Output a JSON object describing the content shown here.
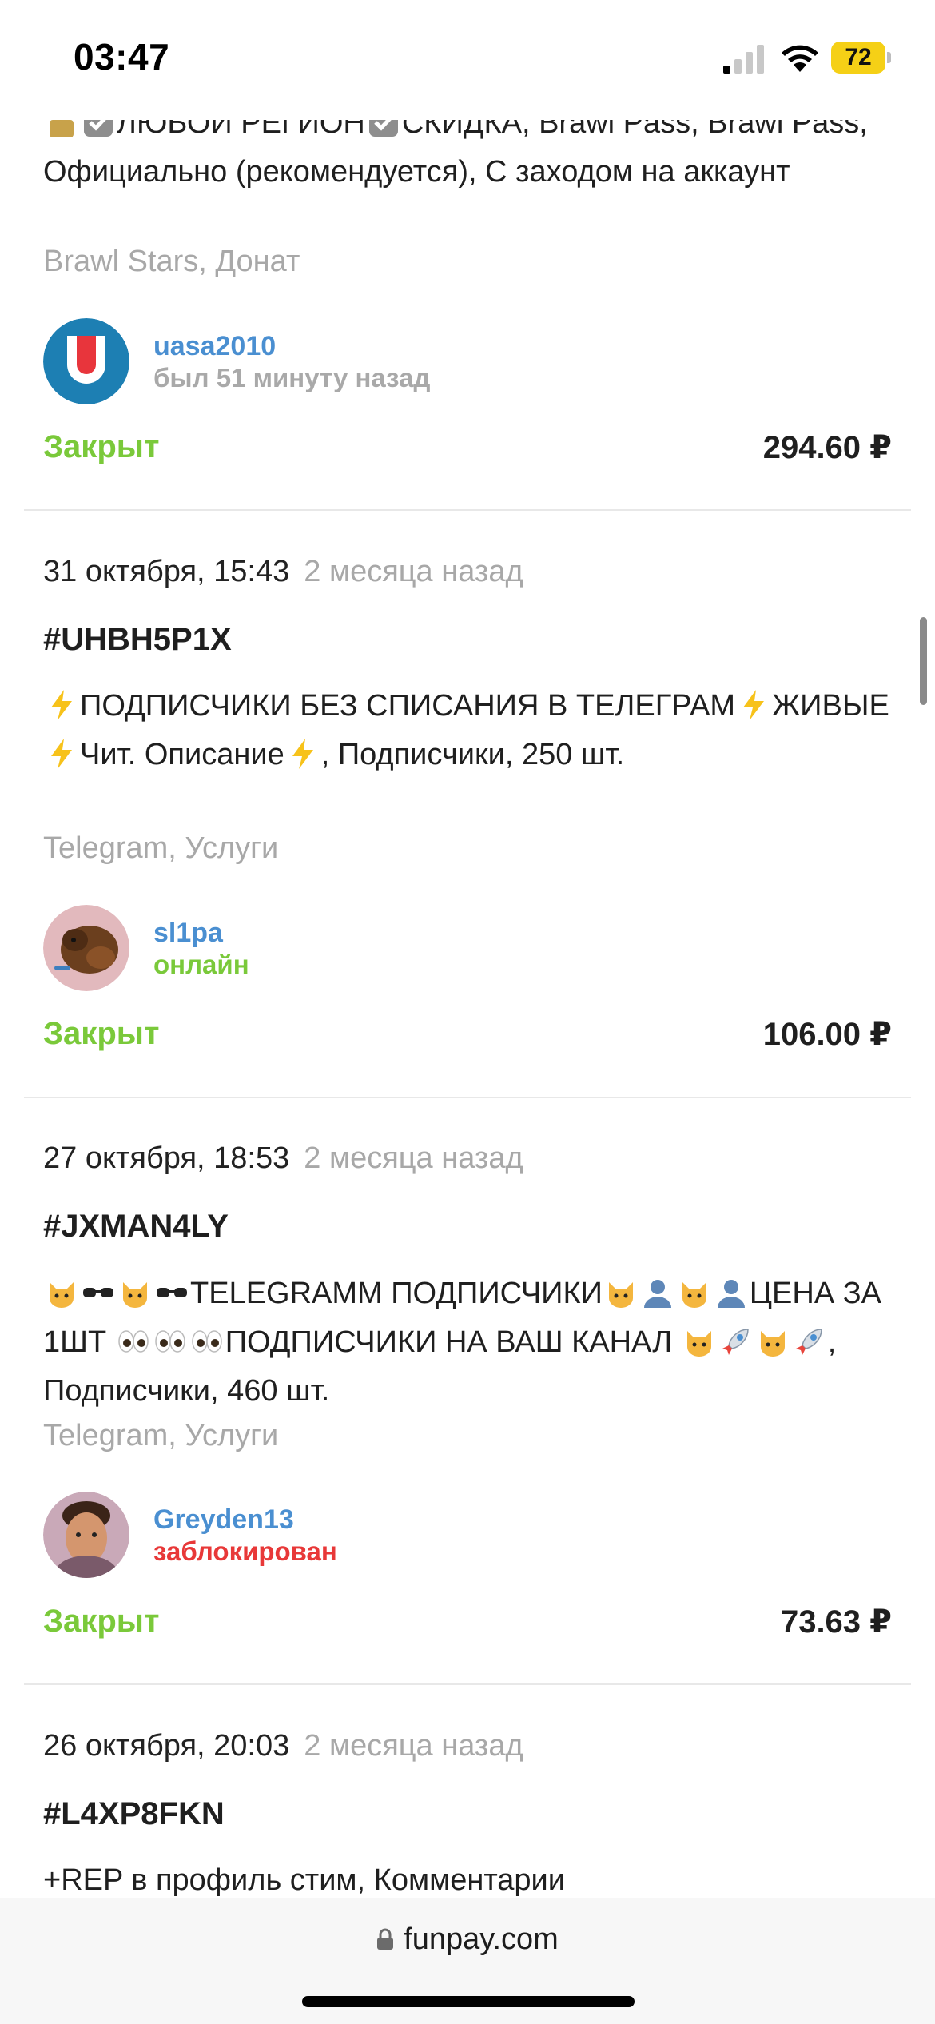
{
  "status_bar": {
    "time": "03:47",
    "battery": "72",
    "icons": [
      "signal-icon",
      "wifi-icon",
      "battery-icon"
    ]
  },
  "orders": [
    {
      "desc_partial": "ЛЮБОЙ РЕГИОН",
      "desc_partial2": "СКИДКА, Brawl Pass, Brawl Pass, Официально (рекомендуется), С заходом на аккаунт",
      "category": "Brawl Stars, Донат",
      "user": {
        "name": "uasa2010",
        "status": "был 51 минуту назад"
      },
      "state": "Закрыт",
      "price": "294.60 ₽"
    },
    {
      "date": "31 октября, 15:43",
      "ago": "2 месяца назад",
      "id": "#UHBH5P1X",
      "desc_parts": [
        "ПОДПИСЧИКИ БЕЗ СПИСАНИЯ В ТЕЛЕГРАМ",
        "ЖИВЫЕ",
        "Чит. Описание",
        ", Подписчики, 250 шт."
      ],
      "category": "Telegram, Услуги",
      "user": {
        "name": "sl1pa",
        "status": "онлайн"
      },
      "state": "Закрыт",
      "price": "106.00 ₽"
    },
    {
      "date": "27 октября, 18:53",
      "ago": "2 месяца назад",
      "id": "#JXMAN4LY",
      "desc_parts": [
        "TELEGRAMM ПОДПИСЧИКИ",
        "ЦЕНА ЗА 1ШТ ",
        "ПОДПИСЧИКИ НА ВАШ КАНАЛ ",
        ", Подписчики, 460 шт."
      ],
      "category": "Telegram, Услуги",
      "user": {
        "name": "Greyden13",
        "status": "заблокирован"
      },
      "state": "Закрыт",
      "price": "73.63 ₽"
    },
    {
      "date": "26 октября, 20:03",
      "ago": "2 месяца назад",
      "id": "#L4XP8FKN",
      "desc": "+REP в профиль стим, Комментарии"
    }
  ],
  "browser": {
    "url": "funpay.com"
  },
  "colors": {
    "closed_green": "#7ac93a",
    "user_blue": "#4a8fd1",
    "blocked_red": "#e83838",
    "muted_gray": "#a8a8a8"
  }
}
